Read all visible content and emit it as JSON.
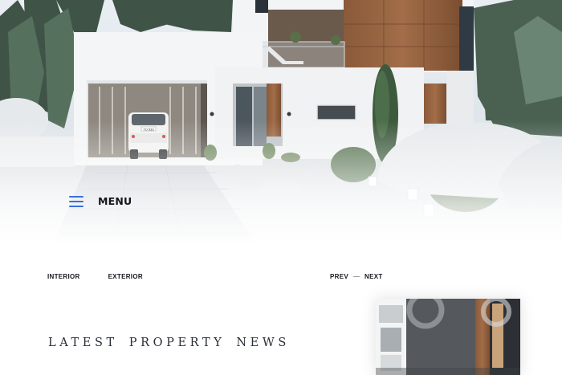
{
  "menu": {
    "label": "MENU",
    "icon": "hamburger-icon",
    "icon_color": "#3a6fe0"
  },
  "tabs": [
    {
      "label": "INTERIOR"
    },
    {
      "label": "EXTERIOR"
    }
  ],
  "pager": {
    "prev_label": "PREV",
    "next_label": "NEXT"
  },
  "section": {
    "title_words": [
      "LATEST",
      "PROPERTY",
      "NEWS"
    ]
  },
  "car_plate": "TO 533",
  "colors": {
    "accent": "#3a6fe0",
    "text": "#15171d",
    "background": "#ffffff"
  }
}
